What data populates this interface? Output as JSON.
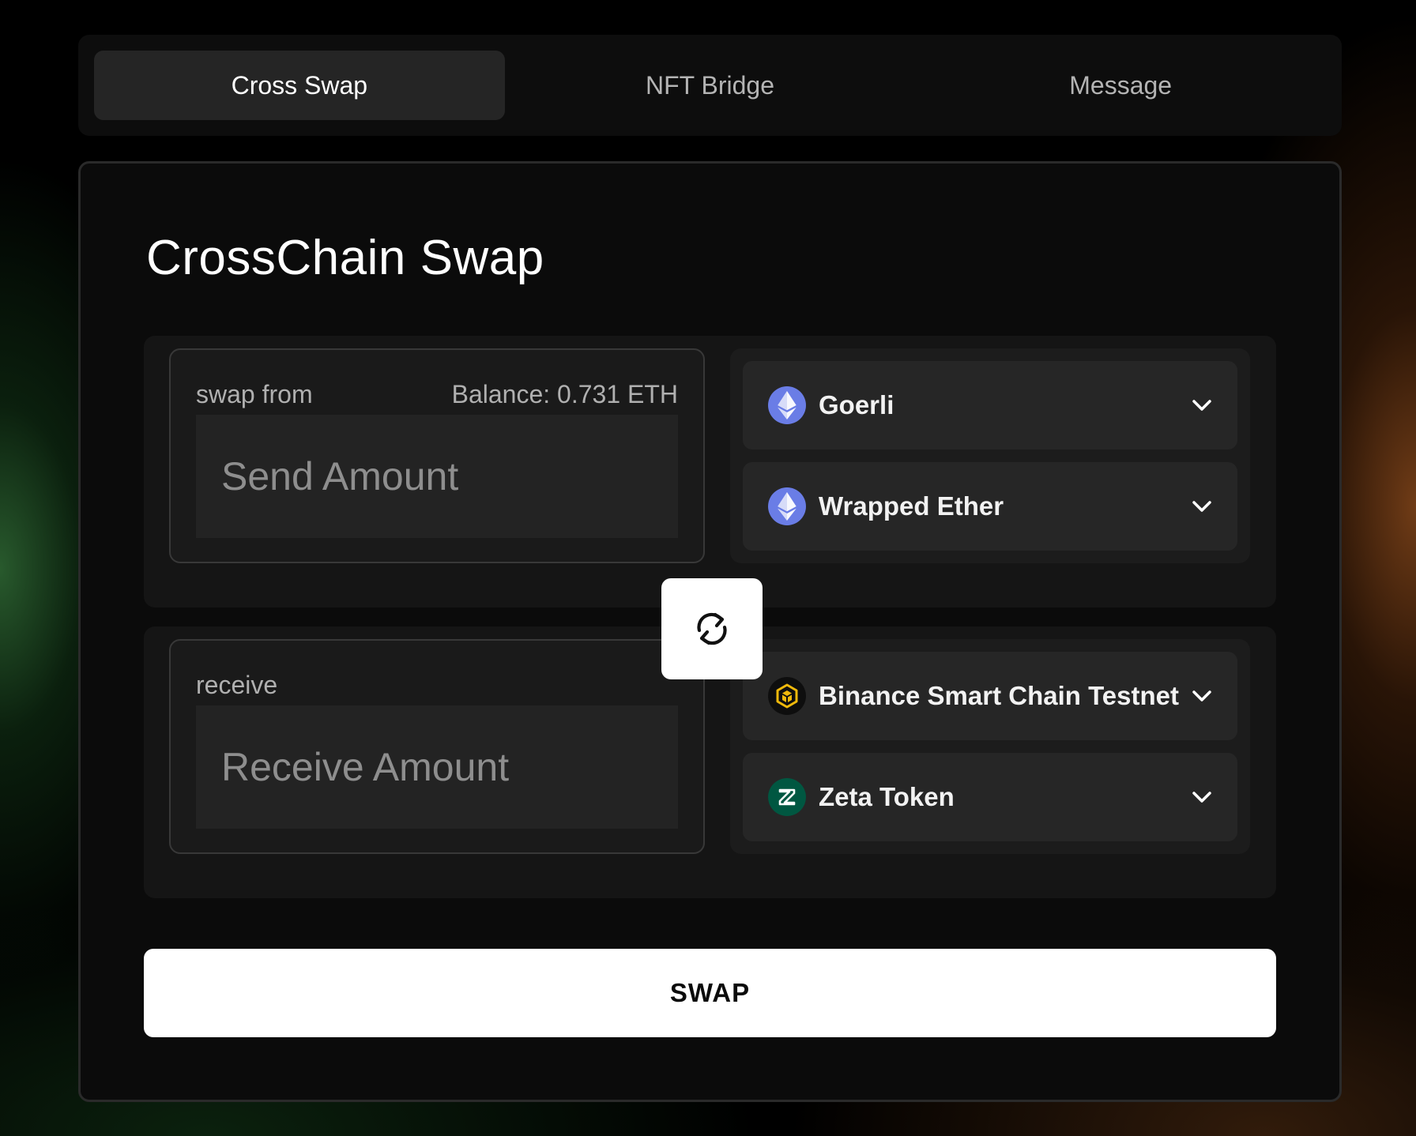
{
  "tabs": [
    {
      "label": "Cross Swap",
      "active": true
    },
    {
      "label": "NFT Bridge",
      "active": false
    },
    {
      "label": "Message",
      "active": false
    }
  ],
  "card": {
    "title": "CrossChain Swap"
  },
  "from": {
    "label": "swap from",
    "balance": "Balance: 0.731 ETH",
    "amount_value": "",
    "amount_placeholder": "Send Amount",
    "network": {
      "label": "Goerli",
      "icon": "ethereum-icon"
    },
    "token": {
      "label": "Wrapped Ether",
      "icon": "ethereum-icon"
    }
  },
  "to": {
    "label": "receive",
    "amount_value": "",
    "amount_placeholder": "Receive Amount",
    "network": {
      "label": "Binance Smart Chain Testnet",
      "icon": "bnb-icon"
    },
    "token": {
      "label": "Zeta Token",
      "icon": "zeta-icon"
    }
  },
  "swap_toggle_icon": "swap-arrows-icon",
  "swap_button": {
    "label": "SWAP"
  },
  "colors": {
    "ethereum": "#6a7de6",
    "bnb": "#f0b90b",
    "zeta": "#005741",
    "accent_button": "#ffffff"
  }
}
